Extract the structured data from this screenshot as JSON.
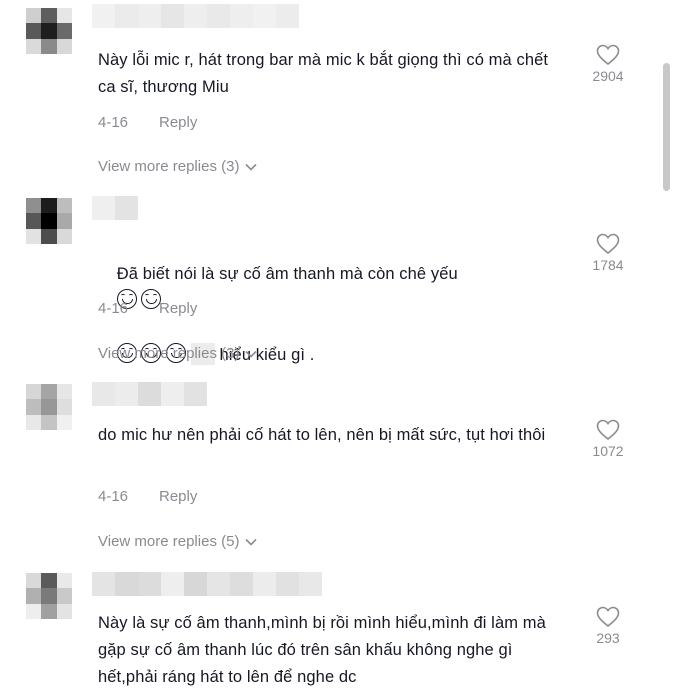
{
  "comments": [
    {
      "text": "Này lỗi mic r, hát trong bar mà mic k bắt giọng thì có mà chết ca sĩ, thương Miu",
      "date": "4-16",
      "reply_label": "Reply",
      "more_replies": "View more replies (3)",
      "likes": "2904",
      "avatar_colors": [
        "#cfcfcf",
        "#5e5e5e",
        "#e6e6e6",
        "#595959",
        "#1e1e1e",
        "#6a6a6a",
        "#dadada",
        "#8a8a8a",
        "#d8d8d8"
      ],
      "name_colors": [
        "#f1f1f1",
        "#ebebeb",
        "#eeeeee",
        "#e6e6e6",
        "#eeeeee",
        "#e9e9e9",
        "#eeeeee",
        "#f1f1f1",
        "#ececec"
      ]
    },
    {
      "text_before": "Đã biết nói là sự cố âm thanh mà còn chê yếu",
      "text_after": " hiểu kiểu gì .",
      "emoji_name": "grinning-face",
      "date": "4-16",
      "reply_label": "Reply",
      "more_replies": "View more replies (3)",
      "likes": "1784",
      "avatar_colors": [
        "#8f8f8f",
        "#1c1c1c",
        "#bdbdbd",
        "#575757",
        "#000000",
        "#a9a9a9",
        "#e2e2e2",
        "#4d4d4d",
        "#d9d9d9"
      ],
      "name_colors": [
        "#efefef",
        "#e3e3e3"
      ]
    },
    {
      "text": "do mic hư nên phải cố hát to lên, nên bị mất sức, tụt hơi thôi",
      "date": "4-16",
      "reply_label": "Reply",
      "more_replies": "View more replies (5)",
      "likes": "1072",
      "avatar_colors": [
        "#d6d6d6",
        "#a5a5a5",
        "#e6e6e6",
        "#bdbdbd",
        "#979797",
        "#dedede",
        "#e8e8e8",
        "#c4c4c4",
        "#f0f0f0"
      ],
      "name_colors": [
        "#e8e8e8",
        "#ececec",
        "#dcdcdc",
        "#eeeeee",
        "#e2e2e2"
      ]
    },
    {
      "text": "Này là sự cố âm thanh,mình bị rồi mình hiểu,mình đi làm mà gặp sự cố âm thanh lúc đó trên sân khấu không nghe gì hết,phải ráng hát to lên để nghe dc",
      "likes": "293",
      "avatar_colors": [
        "#d9d9d9",
        "#5a5a5a",
        "#e9e9e9",
        "#b0b0b0",
        "#7a7a7a",
        "#c9c9c9",
        "#eeeeee",
        "#a0a0a0",
        "#e3e3e3"
      ],
      "name_colors": [
        "#e4e4e4",
        "#d9d9d9",
        "#dcdcdc",
        "#eeeeee",
        "#d7d7d7",
        "#e5e5e5",
        "#dddddd",
        "#ececec",
        "#e1e1e1",
        "#e8e8e8"
      ]
    }
  ]
}
